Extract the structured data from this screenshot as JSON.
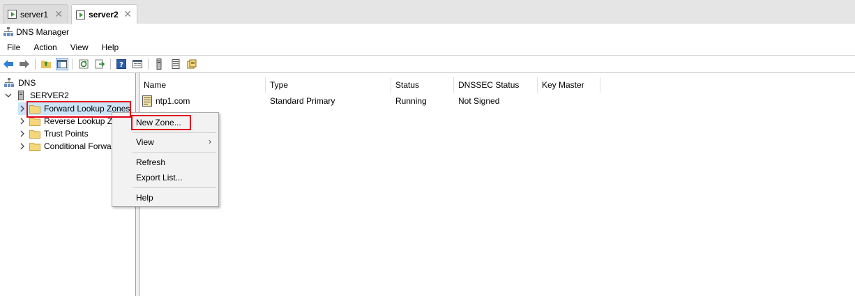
{
  "tabs": [
    {
      "label": "server1",
      "active": false
    },
    {
      "label": "server2",
      "active": true
    }
  ],
  "app": {
    "title": "DNS Manager"
  },
  "menu": [
    "File",
    "Action",
    "View",
    "Help"
  ],
  "tree": {
    "root": "DNS",
    "server": "SERVER2",
    "nodes": [
      {
        "label": "Forward Lookup Zones"
      },
      {
        "label": "Reverse Lookup Zones"
      },
      {
        "label": "Trust Points"
      },
      {
        "label": "Conditional Forwarders"
      }
    ]
  },
  "list": {
    "columns": [
      "Name",
      "Type",
      "Status",
      "DNSSEC Status",
      "Key Master"
    ],
    "rows": [
      {
        "name": "ntp1.com",
        "type": "Standard Primary",
        "status": "Running",
        "dnssec": "Not Signed",
        "key_master": ""
      }
    ]
  },
  "context_menu": {
    "new_zone": "New Zone...",
    "view": "View",
    "refresh": "Refresh",
    "export_list": "Export List...",
    "help": "Help"
  },
  "colors": {
    "highlight": "#e3001b",
    "folder": "#f5d67a",
    "tab_icon": "#3a9a3a"
  }
}
